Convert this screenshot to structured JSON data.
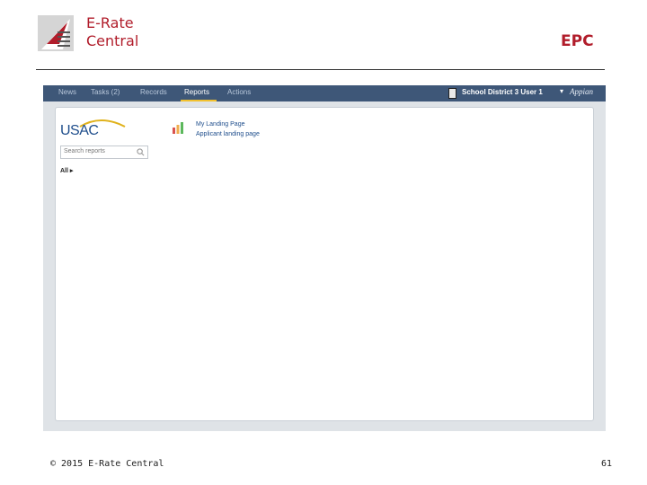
{
  "slide": {
    "brand_line1": "E-Rate",
    "brand_line2": "Central",
    "section_title": "EPC",
    "copyright": "© 2015 E-Rate Central",
    "page_number": "61"
  },
  "app": {
    "nav": [
      {
        "label": "News",
        "active": false
      },
      {
        "label": "Tasks (2)",
        "active": false
      },
      {
        "label": "Records",
        "active": false
      },
      {
        "label": "Reports",
        "active": true
      },
      {
        "label": "Actions",
        "active": false
      }
    ],
    "user_name": "School District 3 User 1",
    "user_caret": "▾",
    "product_logo": "Appian",
    "org_logo": "USAC",
    "search_placeholder": "Search reports",
    "filter_label": "All ▸",
    "reports": [
      {
        "label": "My Landing Page"
      },
      {
        "label": "Applicant landing page"
      }
    ]
  },
  "colors": {
    "accent": "#b11d2b",
    "nav_bg": "#3e5778",
    "nav_active_underline": "#f2c12e",
    "link": "#1f4e8c"
  },
  "icons": [
    "erate-central-logo-icon",
    "user-badge-icon",
    "search-icon",
    "bar-chart-icon"
  ]
}
